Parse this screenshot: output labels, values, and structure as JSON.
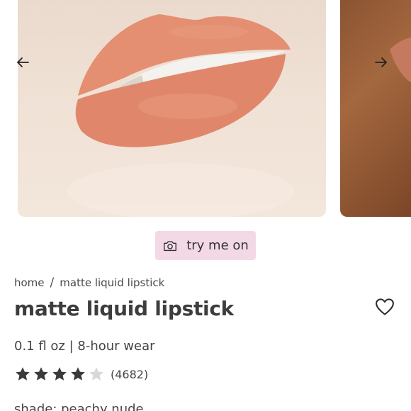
{
  "carousel": {
    "slides": [
      "lips-product-photo",
      "lips-product-photo-2"
    ],
    "prev_icon": "arrow-left-icon",
    "next_icon": "arrow-right-icon"
  },
  "try_on": {
    "label": "try me on",
    "icon": "camera-icon",
    "bg_color": "#f3d9e6"
  },
  "breadcrumb": {
    "home": "home",
    "separator": "/",
    "current": "matte liquid lipstick"
  },
  "product": {
    "title": "matte liquid lipstick",
    "details": "0.1 fl oz | 8-hour wear",
    "rating": 4,
    "rating_max": 5,
    "review_count": "(4682)",
    "shade_text": "shade: peachy nude",
    "wishlist_icon": "heart-outline-icon",
    "star_color": "#3a3a3a",
    "star_empty_color": "#d8d8d8"
  }
}
